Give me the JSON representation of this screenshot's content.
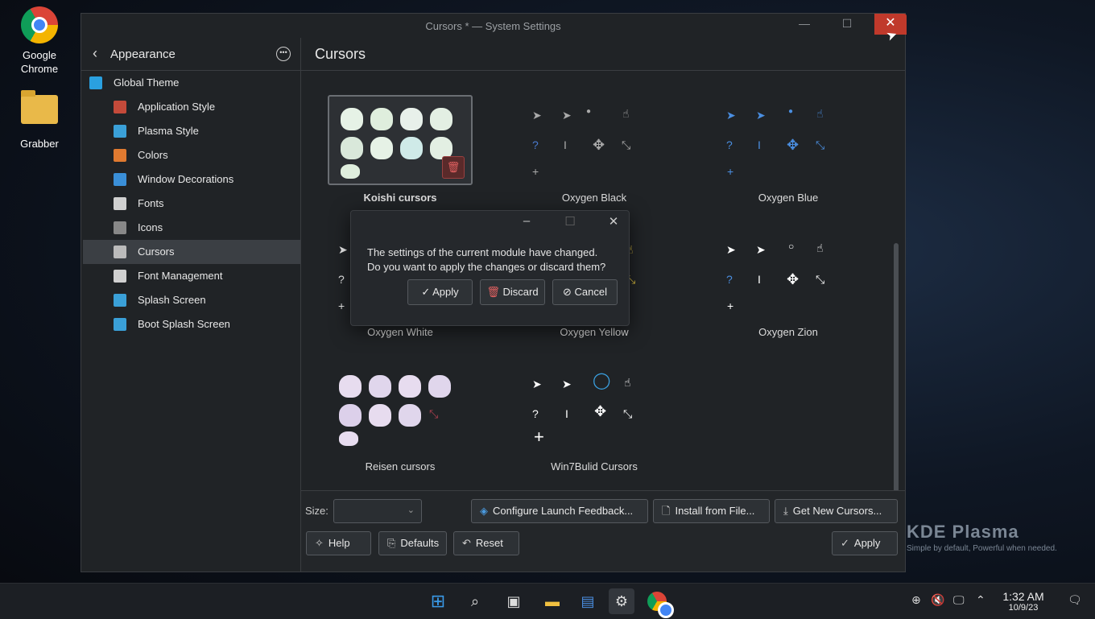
{
  "desktop": {
    "icons": [
      {
        "label_line1": "Google",
        "label_line2": "Chrome"
      },
      {
        "label_line1": "Grabber",
        "label_line2": ""
      }
    ]
  },
  "window": {
    "title": "Cursors * — System Settings",
    "minimize_glyph": "—",
    "maximize_glyph": "☐",
    "close_glyph": "✕"
  },
  "sidebar": {
    "back_label": "Appearance",
    "items": [
      {
        "label": "Global Theme",
        "icon": "global-theme-icon",
        "color": "#2aa0e0"
      },
      {
        "label": "Application Style",
        "icon": "application-style-icon",
        "color": "#c44a3a"
      },
      {
        "label": "Plasma Style",
        "icon": "plasma-style-icon",
        "color": "#3aa0d8"
      },
      {
        "label": "Colors",
        "icon": "colors-icon",
        "color": "#e07a30"
      },
      {
        "label": "Window Decorations",
        "icon": "window-decorations-icon",
        "color": "#3a8fd8"
      },
      {
        "label": "Fonts",
        "icon": "fonts-icon",
        "color": "#d0d0d0"
      },
      {
        "label": "Icons",
        "icon": "icons-icon",
        "color": "#888888"
      },
      {
        "label": "Cursors",
        "icon": "cursors-icon",
        "color": "#bbbbbb"
      },
      {
        "label": "Font Management",
        "icon": "font-management-icon",
        "color": "#d0d0d0"
      },
      {
        "label": "Splash Screen",
        "icon": "splash-screen-icon",
        "color": "#3aa0d8"
      },
      {
        "label": "Boot Splash Screen",
        "icon": "boot-splash-screen-icon",
        "color": "#3aa0d8"
      }
    ],
    "active_index": 7
  },
  "content": {
    "title": "Cursors",
    "themes": [
      {
        "name": "Koishi cursors",
        "selected": true
      },
      {
        "name": "Oxygen Black",
        "selected": false
      },
      {
        "name": "Oxygen Blue",
        "selected": false
      },
      {
        "name": "Oxygen White",
        "selected": false
      },
      {
        "name": "Oxygen Yellow",
        "selected": false
      },
      {
        "name": "Oxygen Zion",
        "selected": false
      },
      {
        "name": "Reisen cursors",
        "selected": false
      },
      {
        "name": "Win7Bulid Cursors",
        "selected": false
      }
    ]
  },
  "bottom": {
    "size_label": "Size:",
    "size_value": "",
    "configure_label": "Configure Launch Feedback...",
    "install_label": "Install from File...",
    "get_new_label": "Get New Cursors...",
    "help_label": "Help",
    "defaults_label": "Defaults",
    "reset_label": "Reset",
    "apply_label": "Apply"
  },
  "dialog": {
    "message_line1": "The settings of the current module have changed.",
    "message_line2": "Do you want to apply the changes or discard them?",
    "apply_label": "Apply",
    "discard_label": "Discard",
    "cancel_label": "Cancel"
  },
  "branding": {
    "title": "KDE Plasma",
    "tagline": "Simple by default, Powerful when  needed."
  },
  "taskbar": {
    "time": "1:32 AM",
    "date": "10/9/23"
  }
}
